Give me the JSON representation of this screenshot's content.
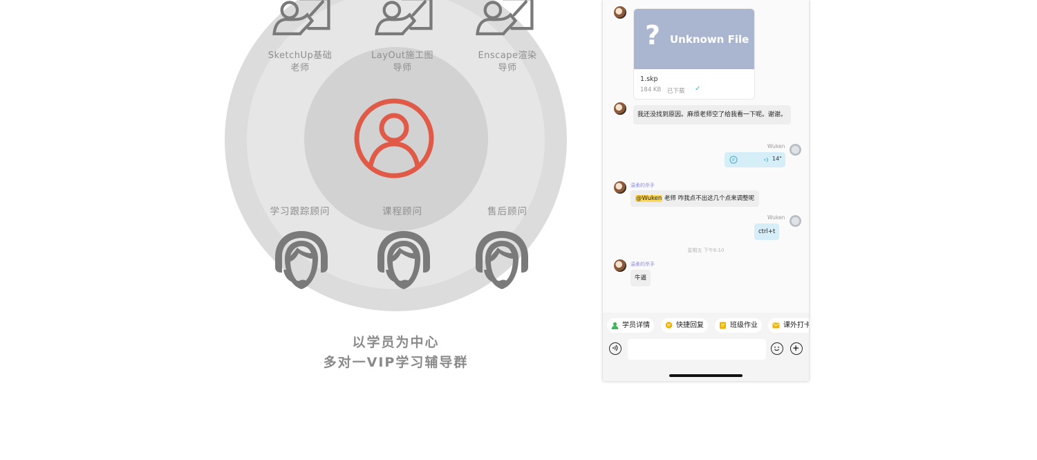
{
  "diagram": {
    "mentors": [
      {
        "line1": "SketchUp基础",
        "line2": "老师",
        "icon": "teacher-board-icon"
      },
      {
        "line1": "LayOut施工图",
        "line2": "导师",
        "icon": "teacher-board-icon"
      },
      {
        "line1": "Enscape渲染",
        "line2": "导师",
        "icon": "teacher-board-icon"
      }
    ],
    "center_icon": "student-user-icon",
    "advisors": [
      {
        "label": "学习跟踪顾问",
        "icon": "headset-agent-icon"
      },
      {
        "label": "课程顾问",
        "icon": "headset-agent-icon"
      },
      {
        "label": "售后顾问",
        "icon": "headset-agent-icon"
      }
    ],
    "caption_line1": "以学员为中心",
    "caption_line2": "多对一VIP学习辅导群",
    "colors": {
      "accent": "#e05a47",
      "ring_outer": "#dcdcdc",
      "ring_mid": "#e6e6e6",
      "ring_inner": "#d2d2d2",
      "icon_gray": "#7a7a7a"
    }
  },
  "chat": {
    "file": {
      "cover_title": "Unknown File",
      "name": "1.skp",
      "size": "184 KB",
      "status": "已下载"
    },
    "messages": {
      "m1": "我还没找到原因。麻烦老师空了给我看一下呢。谢谢。",
      "voice_sender": "Wuken",
      "voice_duration": "14\"",
      "m3_sender": "温柔的杀手",
      "m3_mention": "@Wuken",
      "m3_text": " 老师 咋我点不出这几个点来调整呢",
      "m4_sender": "Wuken",
      "m4_text": "ctrl+t",
      "time_sep": "星期五 下午6:10",
      "m5_sender": "温柔的杀手",
      "m5_text": "牛逼"
    },
    "quick_actions": [
      {
        "label": "学员详情",
        "color": "#3cb55b"
      },
      {
        "label": "快捷回复",
        "color": "#f0b400"
      },
      {
        "label": "班级作业",
        "color": "#f0b400"
      },
      {
        "label": "课外打卡",
        "color": "#f0b400"
      }
    ],
    "input": {
      "placeholder": ""
    }
  }
}
